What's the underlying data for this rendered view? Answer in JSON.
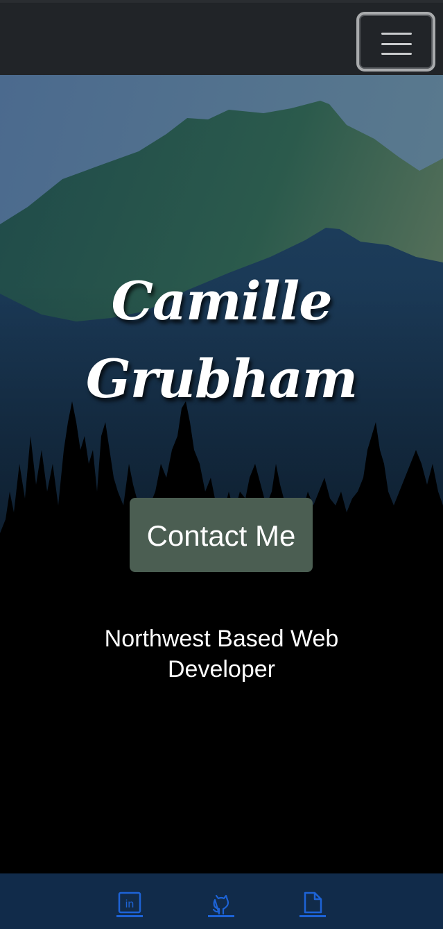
{
  "navbar": {
    "toggler_label": "Toggle navigation"
  },
  "hero": {
    "name_line_1": "Camille",
    "name_line_2": "Grubham",
    "contact_button": "Contact Me",
    "tagline_line_1": "Northwest Based Web",
    "tagline_line_2": "Developer"
  },
  "footer": {
    "links": [
      {
        "icon": "linkedin-icon"
      },
      {
        "icon": "github-icon"
      },
      {
        "icon": "document-icon"
      }
    ]
  },
  "colors": {
    "navbar_bg": "#212428",
    "footer_bg": "#112b4a",
    "button_bg": "#4b5e52",
    "link_blue": "#1d63d6"
  }
}
